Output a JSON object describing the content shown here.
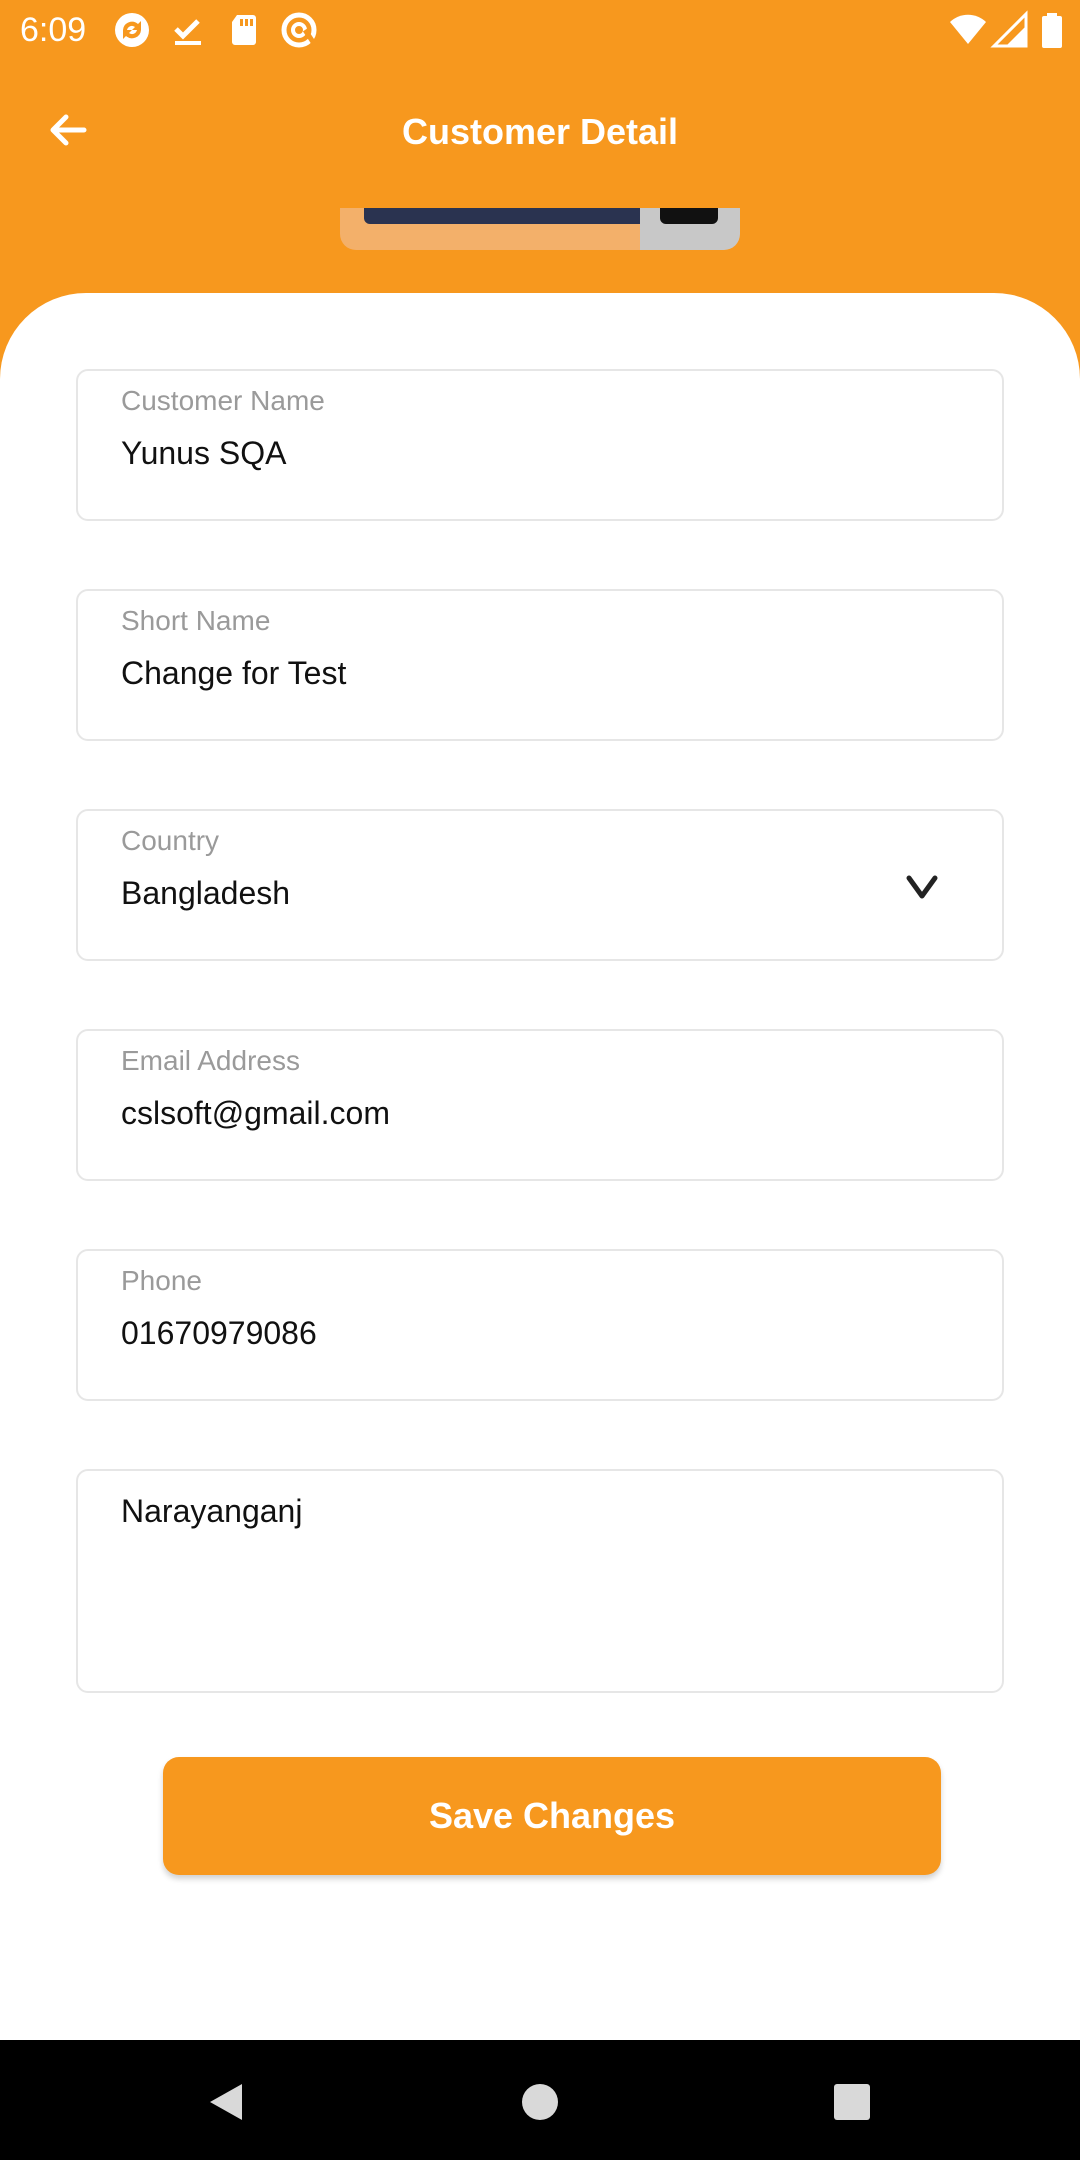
{
  "status_bar": {
    "time": "6:09",
    "left_icons": [
      "sync-icon",
      "download-done-icon",
      "sd-card-icon",
      "at-sign-icon"
    ],
    "right_icons": [
      "wifi-icon",
      "signal-icon",
      "battery-icon"
    ]
  },
  "app_bar": {
    "title": "Customer Detail",
    "back_icon": "arrow-left-icon"
  },
  "colors": {
    "primary": "#F7981E",
    "background": "#FFFFFF",
    "field_border": "#E6E6E6",
    "label": "#9A9A9A",
    "text": "#111111"
  },
  "form": {
    "customer_name": {
      "label": "Customer Name",
      "value": "Yunus SQA"
    },
    "short_name": {
      "label": "Short Name",
      "value": "Change for Test"
    },
    "country": {
      "label": "Country",
      "value": "Bangladesh"
    },
    "email": {
      "label": "Email Address",
      "value": "cslsoft@gmail.com"
    },
    "phone": {
      "label": "Phone",
      "value": "01670979086"
    },
    "address": {
      "value": "Narayanganj"
    }
  },
  "actions": {
    "save_label": "Save Changes"
  },
  "nav_bar": {
    "icons": [
      "back-triangle-icon",
      "home-circle-icon",
      "recents-square-icon"
    ]
  }
}
